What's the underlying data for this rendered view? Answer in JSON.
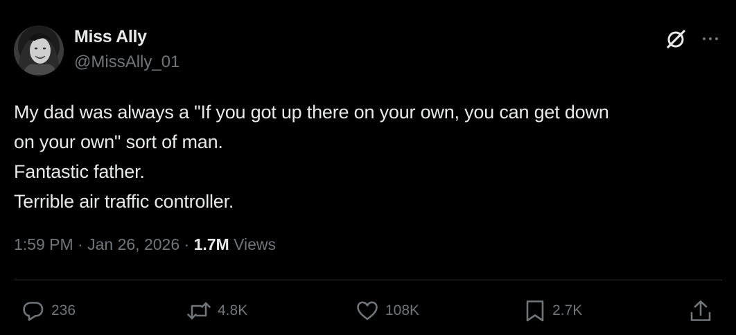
{
  "author": {
    "display_name": "Miss Ally",
    "handle": "@MissAlly_01"
  },
  "tweet": {
    "lines": [
      "My dad was always a \"If you got up there on your own, you can get down",
      "on your own\" sort of man.",
      "Fantastic father.",
      "Terrible air traffic controller."
    ]
  },
  "meta": {
    "time": "1:59 PM",
    "separator": "·",
    "date": "Jan 26, 2026",
    "views_count": "1.7M",
    "views_label": "Views"
  },
  "actions": {
    "replies": "236",
    "reposts": "4.8K",
    "likes": "108K",
    "bookmarks": "2.7K"
  },
  "icons": {
    "grok": "grok-icon",
    "more": "more-icon",
    "reply": "reply-icon",
    "repost": "repost-icon",
    "like": "heart-icon",
    "bookmark": "bookmark-icon",
    "share": "share-icon"
  },
  "colors": {
    "background": "#000000",
    "primary_text": "#e7e9ea",
    "secondary_text": "#71767b",
    "divider": "#2f3336"
  }
}
